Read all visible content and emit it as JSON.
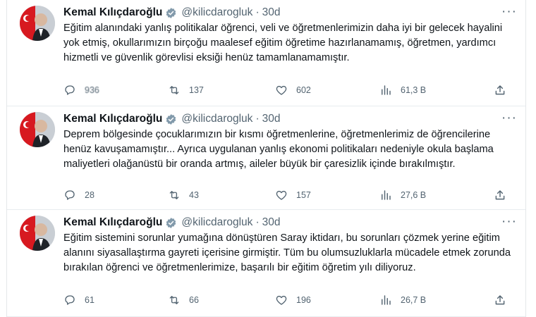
{
  "tweets": [
    {
      "name": "Kemal Kılıçdaroğlu",
      "handle": "@kilicdarogluk",
      "separator": "·",
      "time": "30d",
      "text": "Eğitim alanındaki yanlış politikalar öğrenci, veli ve öğretmenlerimizin daha iyi bir gelecek hayalini yok etmiş, okullarımızın birçoğu maalesef eğitim öğretime hazırlanamamış, öğretmen, yardımcı hizmetli ve güvenlik görevlisi eksiği henüz tamamlanamamıştır.",
      "replies": "936",
      "retweets": "137",
      "likes": "602",
      "views": "61,3 B"
    },
    {
      "name": "Kemal Kılıçdaroğlu",
      "handle": "@kilicdarogluk",
      "separator": "·",
      "time": "30d",
      "text": "Deprem bölgesinde çocuklarımızın bir kısmı öğretmenlerine, öğretmenlerimiz de öğrencilerine henüz kavuşamamıştır... Ayrıca uygulanan yanlış ekonomi politikaları nedeniyle okula başlama maliyetleri olağanüstü bir oranda artmış, aileler büyük bir çaresizlik içinde bırakılmıştır.",
      "replies": "28",
      "retweets": "43",
      "likes": "157",
      "views": "27,6 B"
    },
    {
      "name": "Kemal Kılıçdaroğlu",
      "handle": "@kilicdarogluk",
      "separator": "·",
      "time": "30d",
      "text": "Eğitim sistemini sorunlar yumağına dönüştüren Saray iktidarı, bu sorunları çözmek yerine eğitim alanını siyasallaştırma gayreti içerisine girmiştir. Tüm bu olumsuzluklarla mücadele etmek zorunda bırakılan öğrenci ve öğretmenlerimize, başarılı bir eğitim öğretim yılı diliyoruz.",
      "replies": "61",
      "retweets": "66",
      "likes": "196",
      "views": "26,7 B"
    }
  ],
  "icons": {
    "more": "more-horizontal-icon",
    "verified": "verified-badge-icon",
    "reply": "reply-icon",
    "retweet": "retweet-icon",
    "like": "heart-icon",
    "views": "views-icon",
    "share": "share-icon"
  },
  "colors": {
    "verified_badge": "#829aab",
    "text": "#0f1419",
    "muted": "#536471",
    "avatar_flag_red": "#d71920"
  }
}
